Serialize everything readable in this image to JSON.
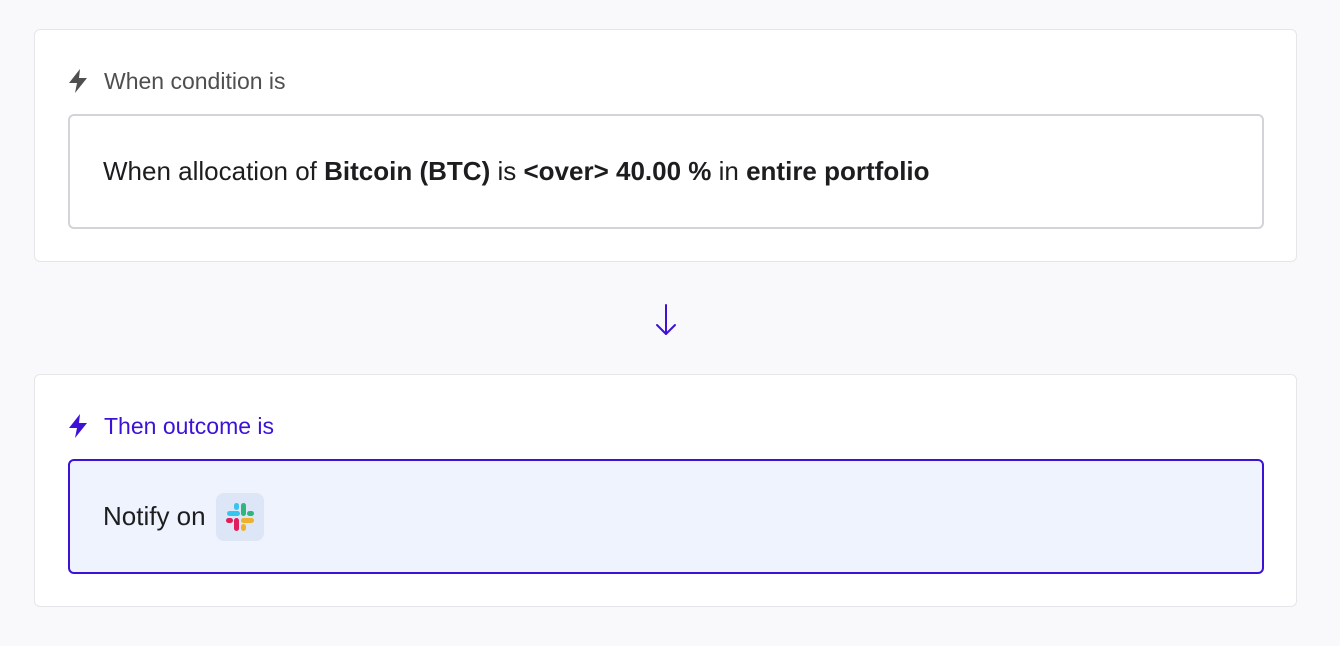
{
  "condition": {
    "header": "When condition is",
    "sentence": {
      "p1": "When allocation of ",
      "asset": "Bitcoin (BTC)",
      "p2": " is ",
      "operator": "<over>",
      "p3": " ",
      "value": "40.00 %",
      "p4": " in ",
      "scope": "entire portfolio"
    }
  },
  "outcome": {
    "header": "Then outcome is",
    "text": "Notify on",
    "channel_icon": "slack-icon"
  },
  "colors": {
    "accent": "#3d12d6",
    "outcome_bg": "#eef3fd",
    "page_bg": "#f9f9fb"
  }
}
